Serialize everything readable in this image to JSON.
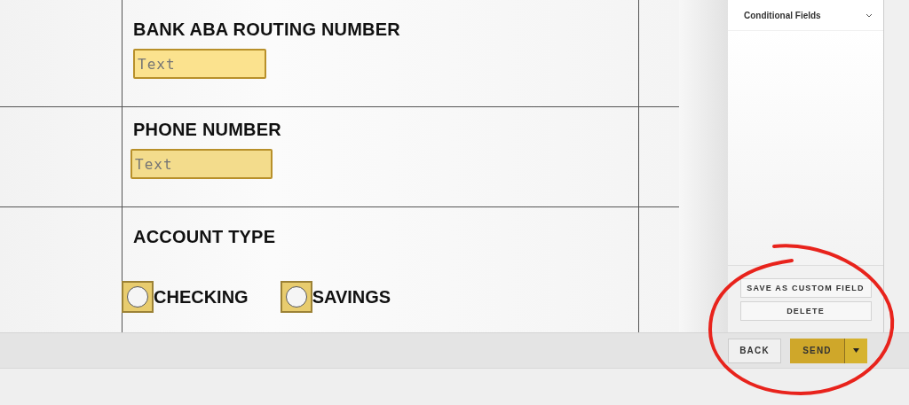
{
  "form_rows": [
    {
      "kind": "text",
      "label": "BANK ABA ROUTING NUMBER",
      "placeholder": "Text"
    },
    {
      "kind": "text",
      "label": "PHONE NUMBER",
      "placeholder": "Text"
    },
    {
      "kind": "radio",
      "label": "ACCOUNT TYPE",
      "options": [
        {
          "label": "CHECKING",
          "selected": false
        },
        {
          "label": "SAVINGS",
          "selected": false
        }
      ]
    }
  ],
  "panel": {
    "title": "Conditional Fields",
    "buttons": [
      "SAVE AS CUSTOM FIELD",
      "DELETE"
    ]
  },
  "footer": {
    "back": "BACK",
    "send": "SEND"
  }
}
